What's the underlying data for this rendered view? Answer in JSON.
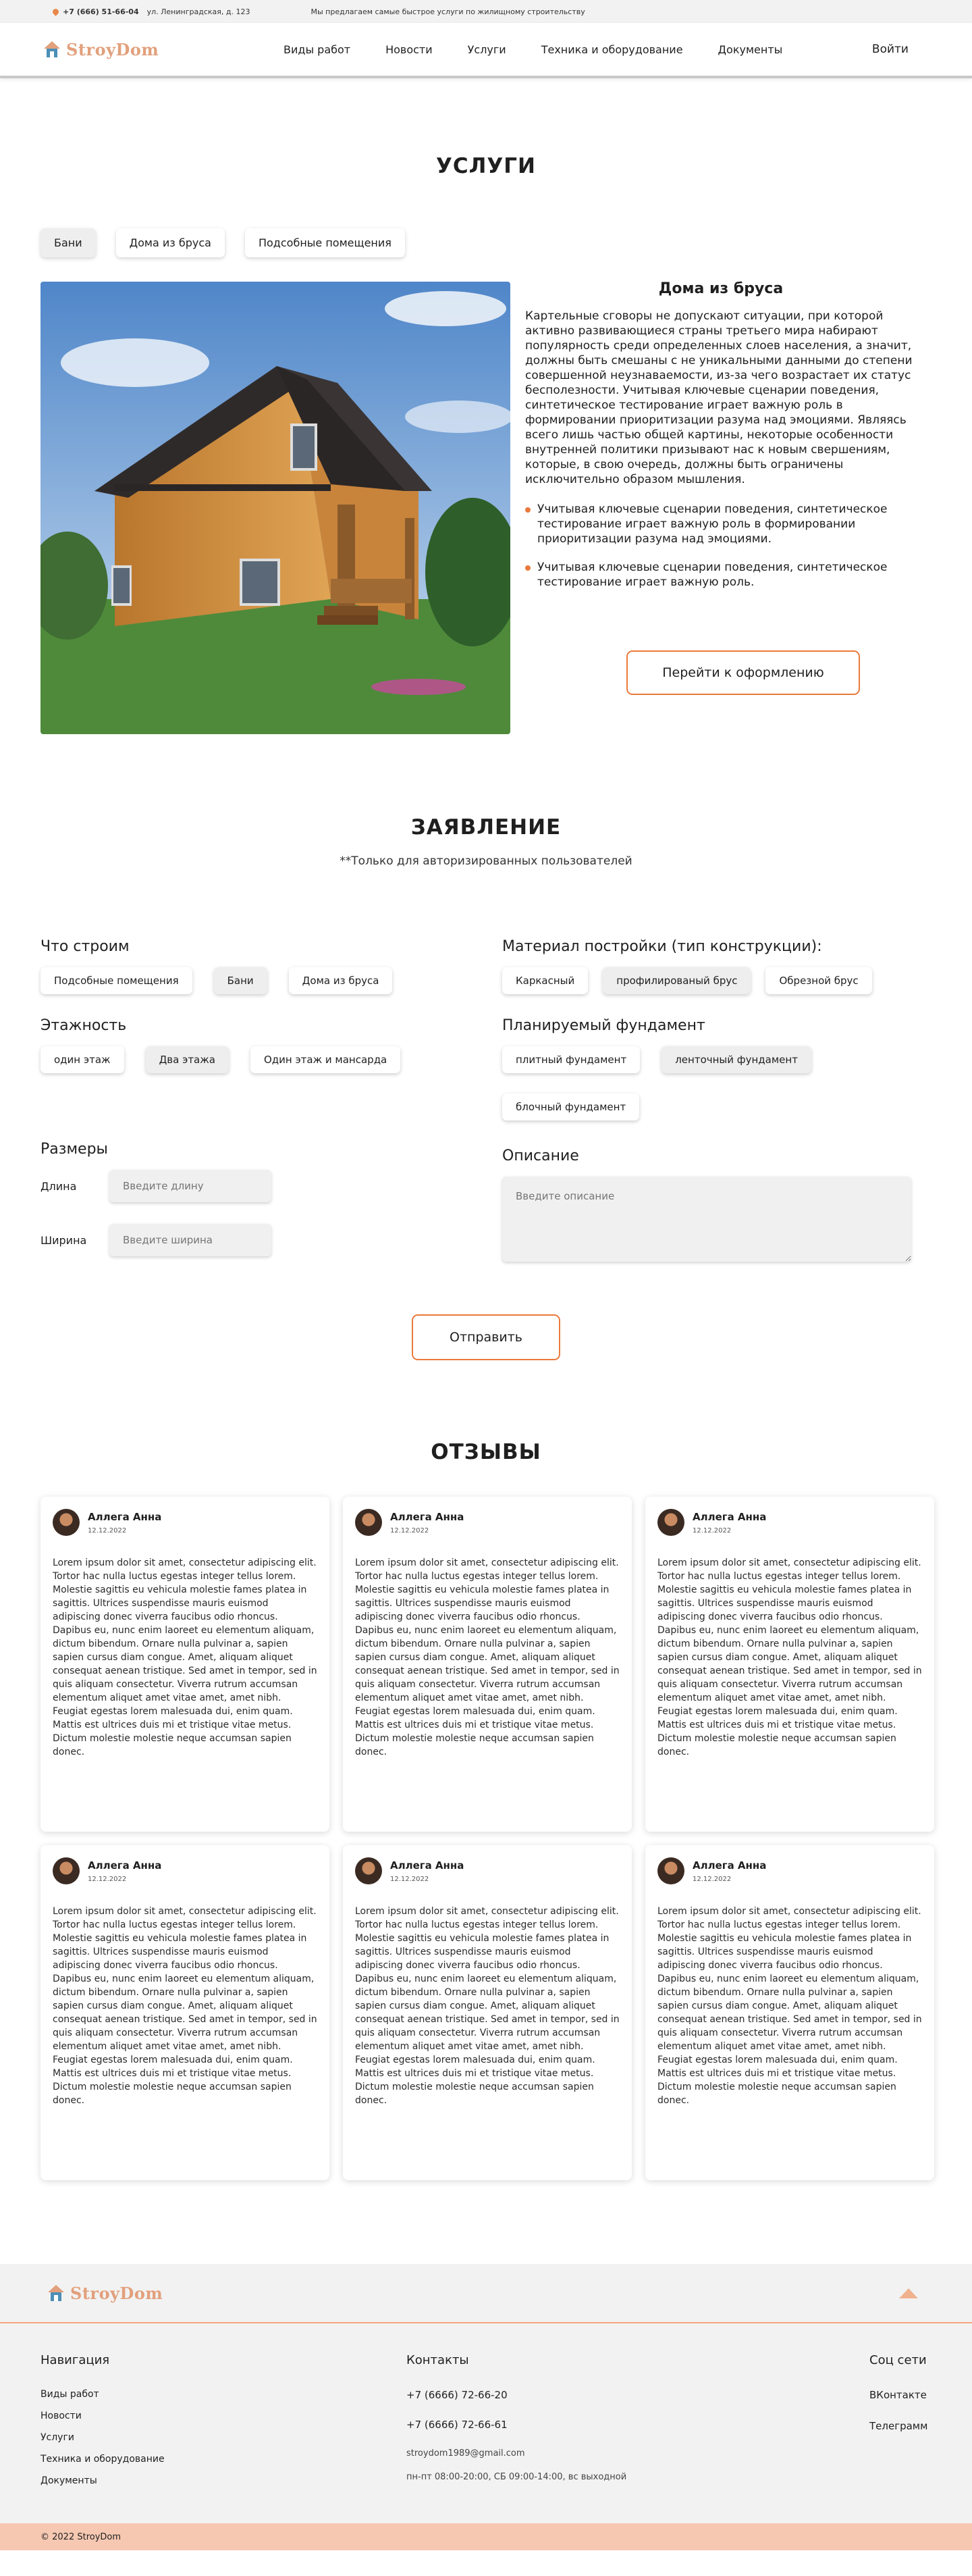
{
  "topbar": {
    "phone": "+7 (666) 51-66-04",
    "address": "ул. Ленинградская, д. 123",
    "promo": "Мы предлагаем самые быстрое услуги по жилищному строительству"
  },
  "header": {
    "logo": "StroyDom",
    "nav": [
      "Виды работ",
      "Новости",
      "Услуги",
      "Техника и оборудование",
      "Документы"
    ],
    "login": "Войти"
  },
  "services": {
    "title": "УСЛУГИ",
    "tabs": [
      "Бани",
      "Дома из бруса",
      "Подсобные помещения"
    ],
    "heading": "Дома из бруса",
    "paragraph": "Картельные сговоры не допускают ситуации, при которой активно развивающиеся страны третьего мира набирают популярность среди определенных слоев населения, а значит, должны быть смешаны с не уникальными данными до степени совершенной неузнаваемости, из-за чего возрастает их статус бесполезности. Учитывая ключевые сценарии поведения, синтетическое тестирование играет важную роль в формировании приоритизации разума над эмоциями. Являясь всего лишь частью общей картины, некоторые особенности внутренней политики призывают нас к новым свершениям, которые, в свою очередь, должны быть ограничены исключительно образом мышления.",
    "bullets": [
      "Учитывая ключевые сценарии поведения, синтетическое тестирование играет важную роль в формировании приоритизации разума над эмоциями.",
      "Учитывая ключевые сценарии поведения, синтетическое тестирование играет важную роль."
    ],
    "button": "Перейти к оформлению"
  },
  "application": {
    "title": "ЗАЯВЛЕНИЕ",
    "note": "**Только для авторизированных пользователей",
    "what_label": "Что строим",
    "what_options": [
      "Подсобные помещения",
      "Бани",
      "Дома из бруса"
    ],
    "material_label": "Материал постройки (тип конструкции):",
    "material_options": [
      "Каркасный",
      "профилированый брус",
      "Обрезной брус"
    ],
    "floors_label": "Этажность",
    "floors_options": [
      "один этаж",
      "Два этажа",
      "Один этаж и мансарда"
    ],
    "foundation_label": "Планируемый фундамент",
    "foundation_options": [
      "плитный фундамент",
      "ленточный фундамент",
      "блочный фундамент"
    ],
    "sizes_label": "Размеры",
    "length_label": "Длина",
    "length_placeholder": "Введите длину",
    "width_label": "Ширина",
    "width_placeholder": "Введите ширина",
    "description_label": "Описание",
    "description_placeholder": "Введите описание",
    "submit": "Отправить"
  },
  "reviews": {
    "title": "ОТЗЫВЫ",
    "items": [
      {
        "name": "Аллега Анна",
        "date": "12.12.2022",
        "text": "Lorem ipsum dolor sit amet, consectetur adipiscing elit. Tortor hac nulla luctus egestas integer tellus lorem. Molestie sagittis eu vehicula molestie fames platea in sagittis. Ultrices suspendisse mauris euismod adipiscing donec viverra faucibus odio rhoncus. Dapibus eu, nunc enim laoreet eu elementum aliquam, dictum bibendum. Ornare nulla pulvinar a, sapien sapien cursus diam congue. Amet, aliquam aliquet consequat aenean tristique. Sed amet in tempor, sed in quis aliquam consectetur. Viverra rutrum accumsan elementum aliquet amet vitae amet, amet nibh. Feugiat egestas lorem malesuada dui, enim quam. Mattis est ultrices duis mi et tristique vitae metus. Dictum molestie molestie neque accumsan sapien donec."
      },
      {
        "name": "Аллега Анна",
        "date": "12.12.2022",
        "text": "Lorem ipsum dolor sit amet, consectetur adipiscing elit. Tortor hac nulla luctus egestas integer tellus lorem. Molestie sagittis eu vehicula molestie fames platea in sagittis. Ultrices suspendisse mauris euismod adipiscing donec viverra faucibus odio rhoncus. Dapibus eu, nunc enim laoreet eu elementum aliquam, dictum bibendum. Ornare nulla pulvinar a, sapien sapien cursus diam congue. Amet, aliquam aliquet consequat aenean tristique. Sed amet in tempor, sed in quis aliquam consectetur. Viverra rutrum accumsan elementum aliquet amet vitae amet, amet nibh. Feugiat egestas lorem malesuada dui, enim quam. Mattis est ultrices duis mi et tristique vitae metus. Dictum molestie molestie neque accumsan sapien donec."
      },
      {
        "name": "Аллега Анна",
        "date": "12.12.2022",
        "text": "Lorem ipsum dolor sit amet, consectetur adipiscing elit. Tortor hac nulla luctus egestas integer tellus lorem. Molestie sagittis eu vehicula molestie fames platea in sagittis. Ultrices suspendisse mauris euismod adipiscing donec viverra faucibus odio rhoncus. Dapibus eu, nunc enim laoreet eu elementum aliquam, dictum bibendum. Ornare nulla pulvinar a, sapien sapien cursus diam congue. Amet, aliquam aliquet consequat aenean tristique. Sed amet in tempor, sed in quis aliquam consectetur. Viverra rutrum accumsan elementum aliquet amet vitae amet, amet nibh. Feugiat egestas lorem malesuada dui, enim quam. Mattis est ultrices duis mi et tristique vitae metus. Dictum molestie molestie neque accumsan sapien donec."
      },
      {
        "name": "Аллега Анна",
        "date": "12.12.2022",
        "text": "Lorem ipsum dolor sit amet, consectetur adipiscing elit. Tortor hac nulla luctus egestas integer tellus lorem. Molestie sagittis eu vehicula molestie fames platea in sagittis. Ultrices suspendisse mauris euismod adipiscing donec viverra faucibus odio rhoncus. Dapibus eu, nunc enim laoreet eu elementum aliquam, dictum bibendum. Ornare nulla pulvinar a, sapien sapien cursus diam congue. Amet, aliquam aliquet consequat aenean tristique. Sed amet in tempor, sed in quis aliquam consectetur. Viverra rutrum accumsan elementum aliquet amet vitae amet, amet nibh. Feugiat egestas lorem malesuada dui, enim quam. Mattis est ultrices duis mi et tristique vitae metus. Dictum molestie molestie neque accumsan sapien donec."
      },
      {
        "name": "Аллега Анна",
        "date": "12.12.2022",
        "text": "Lorem ipsum dolor sit amet, consectetur adipiscing elit. Tortor hac nulla luctus egestas integer tellus lorem. Molestie sagittis eu vehicula molestie fames platea in sagittis. Ultrices suspendisse mauris euismod adipiscing donec viverra faucibus odio rhoncus. Dapibus eu, nunc enim laoreet eu elementum aliquam, dictum bibendum. Ornare nulla pulvinar a, sapien sapien cursus diam congue. Amet, aliquam aliquet consequat aenean tristique. Sed amet in tempor, sed in quis aliquam consectetur. Viverra rutrum accumsan elementum aliquet amet vitae amet, amet nibh. Feugiat egestas lorem malesuada dui, enim quam. Mattis est ultrices duis mi et tristique vitae metus. Dictum molestie molestie neque accumsan sapien donec."
      },
      {
        "name": "Аллега Анна",
        "date": "12.12.2022",
        "text": "Lorem ipsum dolor sit amet, consectetur adipiscing elit. Tortor hac nulla luctus egestas integer tellus lorem. Molestie sagittis eu vehicula molestie fames platea in sagittis. Ultrices suspendisse mauris euismod adipiscing donec viverra faucibus odio rhoncus. Dapibus eu, nunc enim laoreet eu elementum aliquam, dictum bibendum. Ornare nulla pulvinar a, sapien sapien cursus diam congue. Amet, aliquam aliquet consequat aenean tristique. Sed amet in tempor, sed in quis aliquam consectetur. Viverra rutrum accumsan elementum aliquet amet vitae amet, amet nibh. Feugiat egestas lorem malesuada dui, enim quam. Mattis est ultrices duis mi et tristique vitae metus. Dictum molestie molestie neque accumsan sapien donec."
      }
    ]
  },
  "footer": {
    "logo": "StroyDom",
    "nav_title": "Навигация",
    "nav": [
      "Виды работ",
      "Новости",
      "Услуги",
      "Техника и оборудование",
      "Документы"
    ],
    "contacts_title": "Контакты",
    "contacts": [
      "+7 (6666) 72-66-20",
      "+7 (6666) 72-66-61",
      "stroydom1989@gmail.com",
      "пн-пт 08:00-20:00, СБ 09:00-14:00, вс выходной"
    ],
    "social_title": "Соц сети",
    "social": [
      "ВКонтакте",
      "Телеграмм"
    ],
    "copyright": "© 2022 StroyDom"
  },
  "colors": {
    "accent": "#ea7a3c",
    "logo": "#e2a07c",
    "footer_bar": "#f6c8b2"
  }
}
